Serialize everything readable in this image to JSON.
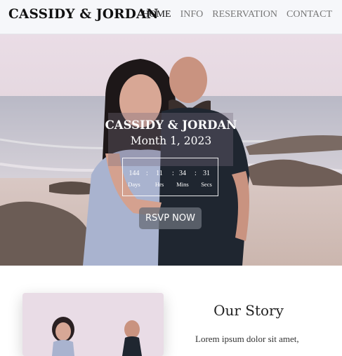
{
  "header": {
    "brand": "CASSIDY & JORDAN",
    "nav": [
      {
        "label": "HOME",
        "active": true
      },
      {
        "label": "INFO",
        "active": false
      },
      {
        "label": "RESERVATION",
        "active": false
      },
      {
        "label": "CONTACT",
        "active": false
      }
    ]
  },
  "hero": {
    "names": "CASSIDY & JORDAN",
    "date": "Month 1, 2023",
    "countdown": [
      {
        "value": "144",
        "label": "Days"
      },
      {
        "value": "11",
        "label": "Hrs"
      },
      {
        "value": "34",
        "label": "Mins"
      },
      {
        "value": "31",
        "label": "Secs"
      }
    ],
    "separator": ":",
    "rsvp_label": "RSVP NOW"
  },
  "story": {
    "title": "Our Story",
    "text": "Lorem ipsum dolor sit amet,"
  },
  "colors": {
    "header_bg": "#f6f7fa",
    "hero_sky": "#e7dbe2",
    "button_bg": "#6c717a"
  }
}
